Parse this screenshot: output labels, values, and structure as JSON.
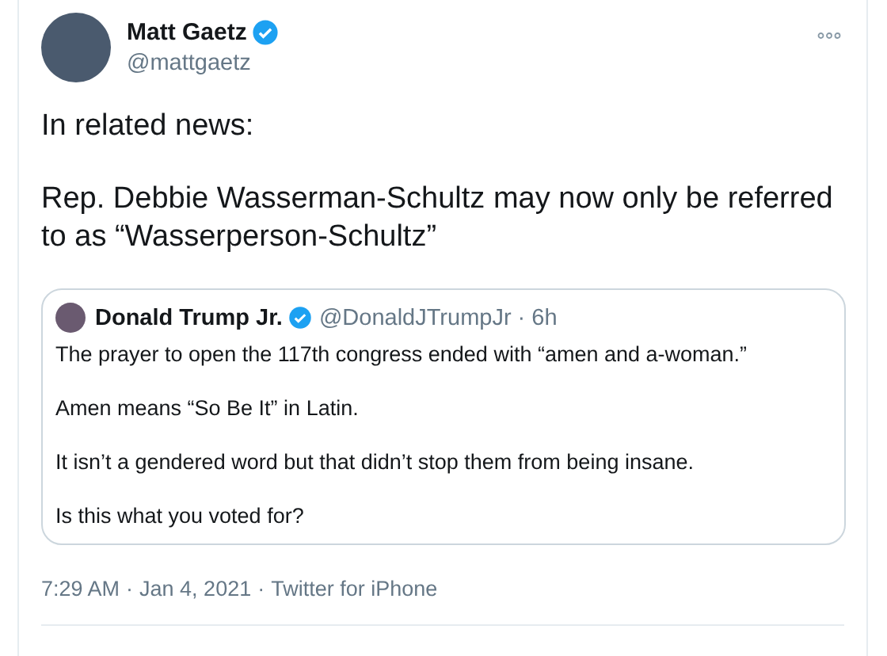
{
  "author": {
    "name": "Matt Gaetz",
    "handle": "@mattgaetz",
    "verified": true
  },
  "body": [
    "In related news:",
    "Rep. Debbie Wasserman-Schultz may now only be referred to as “Wasserperson-Schultz”"
  ],
  "quoted_tweet": {
    "name": "Donald Trump Jr.",
    "verified": true,
    "handle": "@DonaldJTrumpJr",
    "separator": "·",
    "time": "6h",
    "paragraphs": [
      "The prayer to open the 117th congress ended with “amen and a-woman.”",
      "Amen means “So Be It” in Latin.",
      "It isn’t a gendered word but that didn’t stop them from being insane.",
      "Is this what you voted for?"
    ]
  },
  "meta": [
    "7:29 AM",
    "·",
    "Jan 4, 2021",
    "·",
    "Twitter for iPhone"
  ]
}
